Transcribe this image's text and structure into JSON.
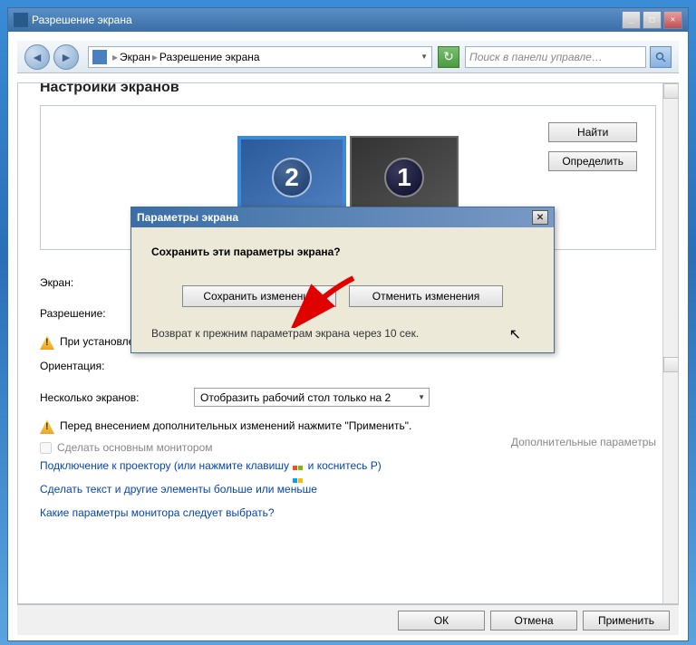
{
  "window": {
    "title": "Разрешение экрана"
  },
  "nav": {
    "item1": "Экран",
    "item2": "Разрешение экрана",
    "search_placeholder": "Поиск в панели управле…"
  },
  "main": {
    "heading": "Настройки экранов",
    "monitor_2": "2",
    "monitor_1": "1",
    "find_btn": "Найти",
    "identify_btn": "Определить"
  },
  "form": {
    "screen_label": "Экран:",
    "resolution_label": "Разрешение:",
    "warn1": "При установленном разрешении изображение может не уместиться на экран.",
    "orientation_label": "Ориентация:",
    "multi_label": "Несколько экранов:",
    "multi_value": "Отобразить рабочий стол только на 2",
    "warn2": "Перед внесением дополнительных изменений нажмите \"Применить\".",
    "main_monitor_chk": "Сделать основным монитором",
    "advanced": "Дополнительные параметры",
    "link1": "Подключение к проектору (или нажмите клавишу",
    "link1_suffix": "и коснитесь P)",
    "link2": "Сделать текст и другие элементы больше или меньше",
    "link3": "Какие параметры монитора следует выбрать?"
  },
  "footer": {
    "ok": "ОК",
    "cancel": "Отмена",
    "apply": "Применить"
  },
  "dialog": {
    "title": "Параметры экрана",
    "question": "Сохранить эти параметры экрана?",
    "save_btn": "Сохранить изменения",
    "revert_btn": "Отменить изменения",
    "countdown": "Возврат к прежним параметрам экрана через 10 сек."
  }
}
